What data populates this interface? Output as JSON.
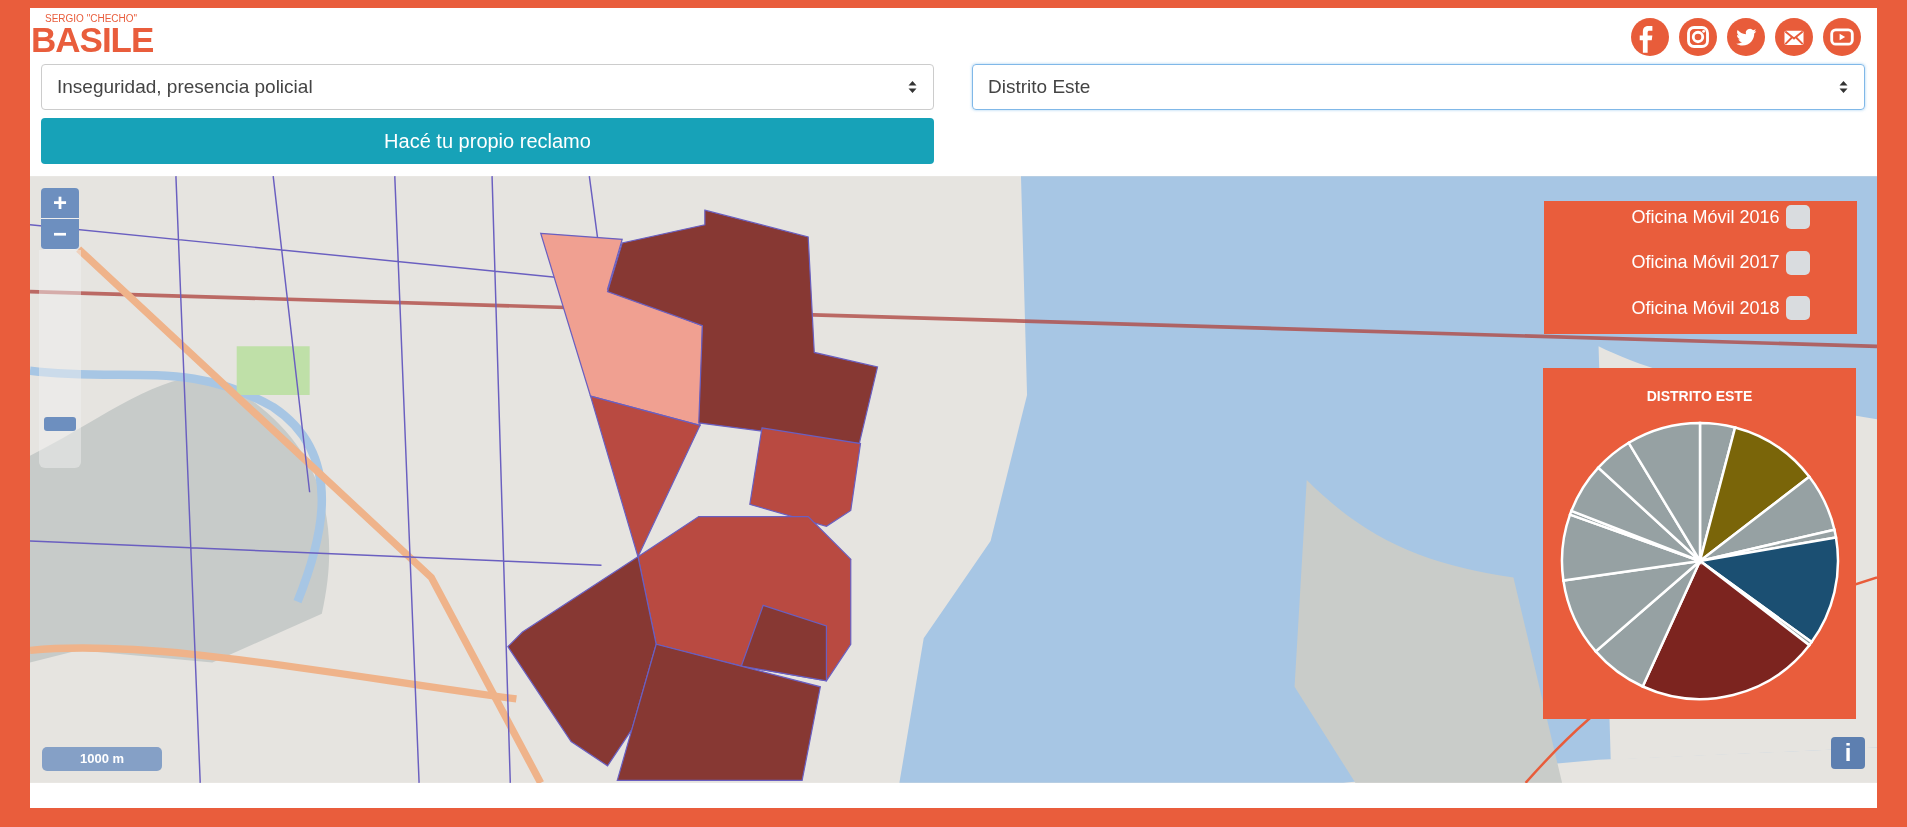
{
  "logo": {
    "tagline": "SERGIO \"CHECHO\"",
    "name": "BASILE"
  },
  "social_links": [
    {
      "kind": "facebook"
    },
    {
      "kind": "instagram"
    },
    {
      "kind": "twitter"
    },
    {
      "kind": "mail"
    },
    {
      "kind": "youtube"
    }
  ],
  "filters": [
    {
      "value": "Inseguridad, presencia policial",
      "focused": false
    },
    {
      "value": "Distrito Este",
      "focused": true
    }
  ],
  "action_button": "Hacé tu propio reclamo",
  "map": {
    "zoom_in": "+",
    "zoom_out": "−",
    "zoom_slider": {
      "level": 0.17
    },
    "scale": "1000 m",
    "info_button": "i"
  },
  "layers": [
    {
      "label": "Oficina Móvil 2016",
      "checked": false
    },
    {
      "label": "Oficina Móvil 2017",
      "checked": false
    },
    {
      "label": "Oficina Móvil 2018",
      "checked": false
    }
  ],
  "chart_panel": {
    "title": "DISTRITO ESTE"
  }
}
